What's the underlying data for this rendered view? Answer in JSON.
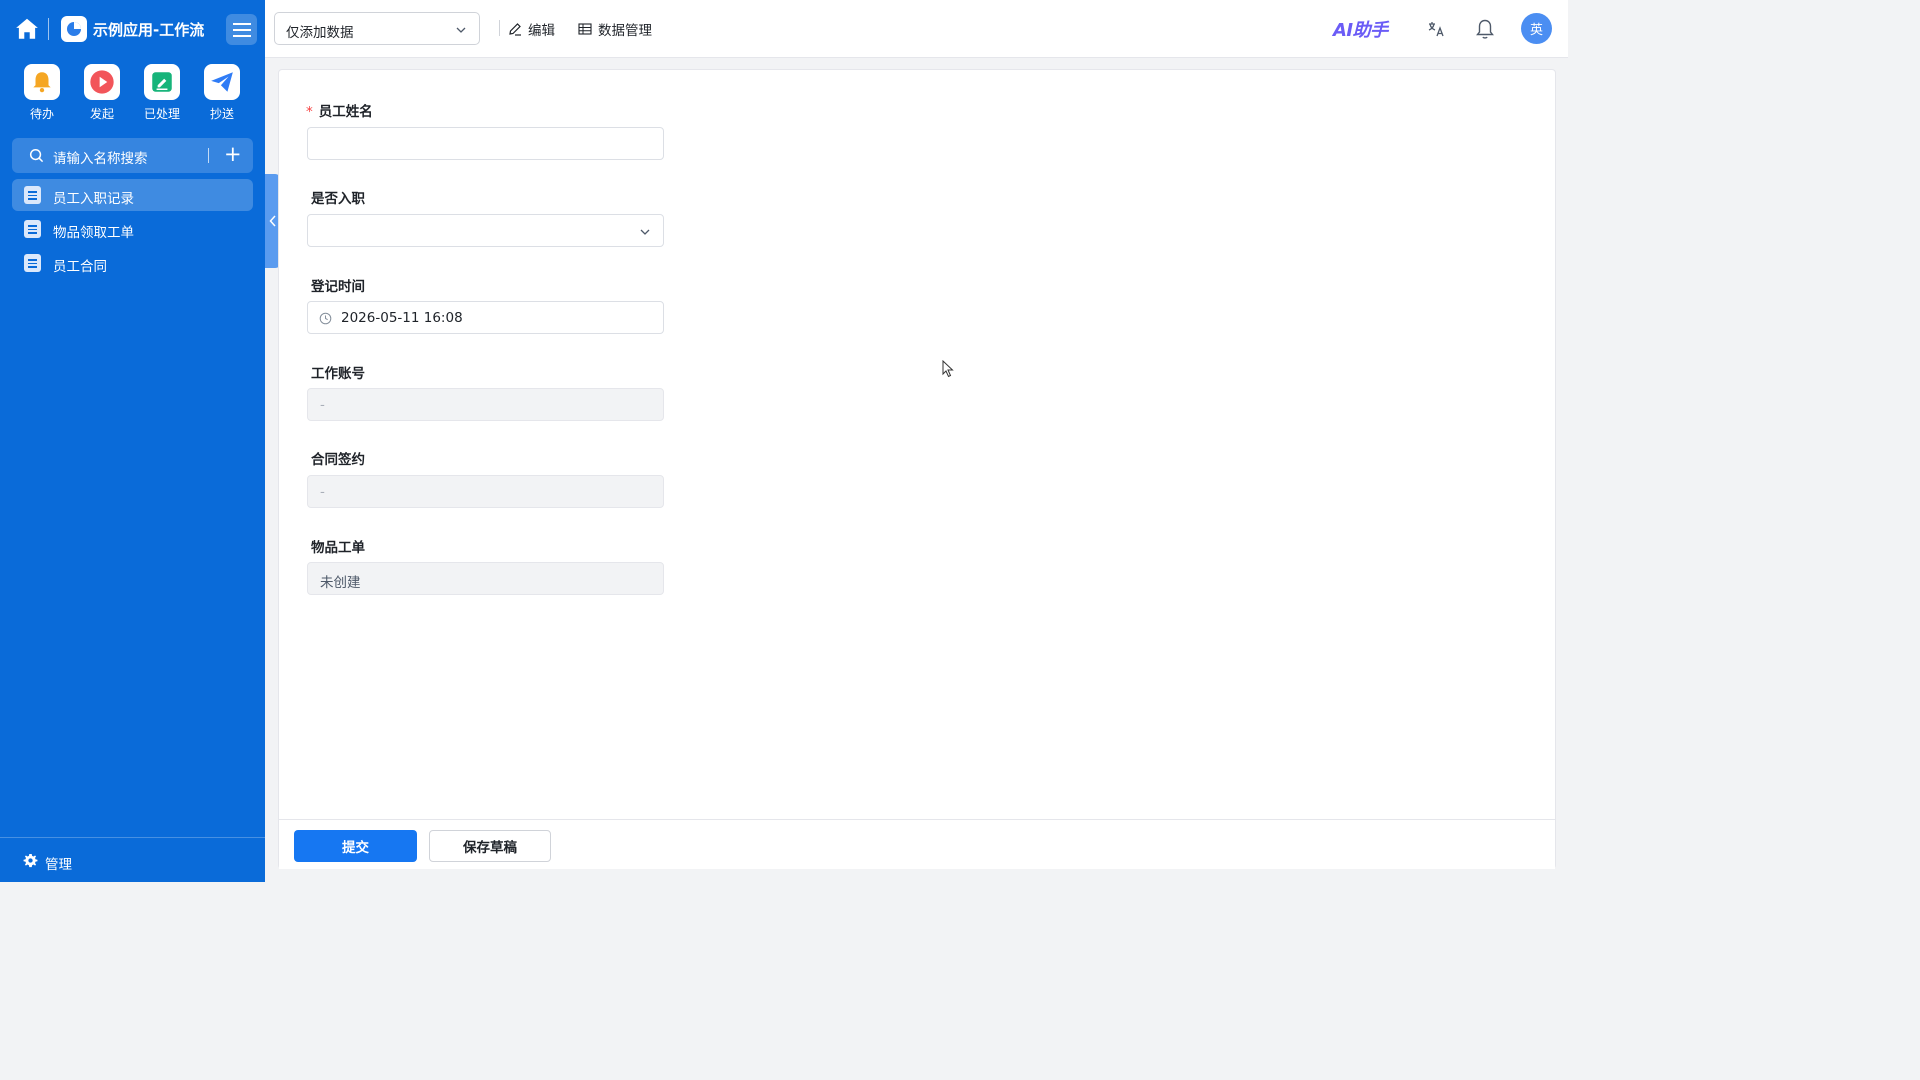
{
  "sidebar": {
    "app_title": "示例应用-工作流",
    "quick_actions": [
      {
        "label": "待办",
        "icon": "bell-icon",
        "color": "#f5a623"
      },
      {
        "label": "发起",
        "icon": "play-icon",
        "color": "#f2555a"
      },
      {
        "label": "已处理",
        "icon": "check-doc-icon",
        "color": "#16b47a"
      },
      {
        "label": "抄送",
        "icon": "send-icon",
        "color": "#2f7cf6"
      }
    ],
    "search_placeholder": "请输入名称搜索",
    "items": [
      {
        "label": "员工入职记录",
        "active": true
      },
      {
        "label": "物品领取工单",
        "active": false
      },
      {
        "label": "员工合同",
        "active": false
      }
    ],
    "manage_label": "管理"
  },
  "header": {
    "view_select": "仅添加数据",
    "edit_label": "编辑",
    "data_manage_label": "数据管理",
    "ai_label": "AI助手",
    "avatar_text": "英"
  },
  "form": {
    "fields": [
      {
        "label": "员工姓名",
        "required": true,
        "type": "text",
        "value": ""
      },
      {
        "label": "是否入职",
        "required": false,
        "type": "select",
        "value": ""
      },
      {
        "label": "登记时间",
        "required": false,
        "type": "datetime",
        "value": "2026-05-11 16:08"
      },
      {
        "label": "工作账号",
        "required": false,
        "type": "readonly",
        "value": "-"
      },
      {
        "label": "合同签约",
        "required": false,
        "type": "readonly",
        "value": "-"
      },
      {
        "label": "物品工单",
        "required": false,
        "type": "readonly",
        "value": "未创建"
      }
    ],
    "submit_label": "提交",
    "draft_label": "保存草稿"
  },
  "colors": {
    "sidebar_bg": "#0a6bd9",
    "primary": "#1677f2",
    "required": "#f53f3f"
  }
}
